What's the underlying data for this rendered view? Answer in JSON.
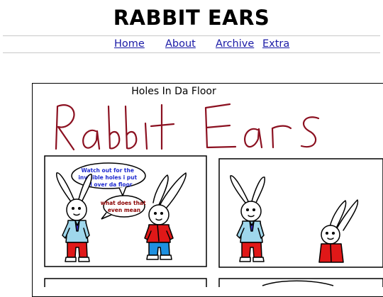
{
  "site": {
    "title": "RABBIT EARS"
  },
  "nav": {
    "home": "Home",
    "about": "About",
    "archive": "Archive",
    "extra": "Extra"
  },
  "comic": {
    "title": "Holes In Da Floor",
    "logo_text": "Rabbit Ears",
    "panel1": {
      "bubble1": [
        "Watch out for the",
        "invisible holes i put",
        "all over da floor"
      ],
      "bubble2": [
        "what does that",
        "even mean"
      ]
    }
  },
  "colors": {
    "nav_link": "#1a1aa6",
    "logo_ink": "#8b1020",
    "bubble1_text": "#1f2bd0",
    "bubble2_text": "#8b0000",
    "shirt_blue": "#9fd7ec",
    "pants_red": "#e01818",
    "jacket_red": "#e01818",
    "pants_blue": "#1e90e0",
    "tie_blue": "#3a2fd0"
  }
}
